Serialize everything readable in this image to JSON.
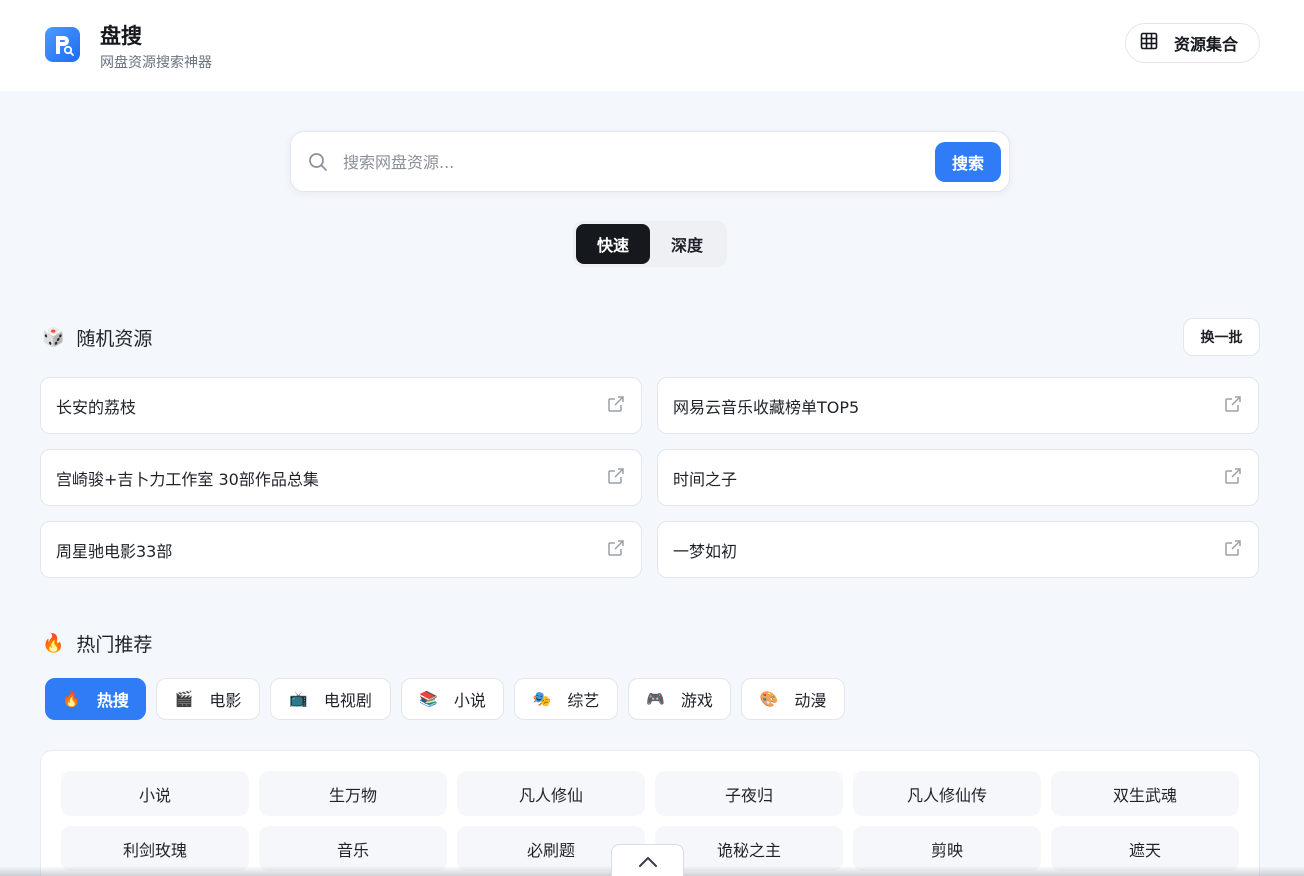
{
  "header": {
    "title": "盘搜",
    "subtitle": "网盘资源搜索神器",
    "collection_button": "资源集合"
  },
  "search": {
    "placeholder": "搜索网盘资源...",
    "button": "搜索"
  },
  "modes": [
    {
      "label": "快速",
      "active": true
    },
    {
      "label": "深度",
      "active": false
    }
  ],
  "random": {
    "title": "随机资源",
    "icon": "🎲",
    "refresh_button": "换一批",
    "items": [
      "长安的荔枝",
      "网易云音乐收藏榜单TOP5",
      "宫崎骏+吉卜力工作室 30部作品总集",
      "时间之子",
      "周星驰电影33部",
      "一梦如初"
    ]
  },
  "hot": {
    "title": "热门推荐",
    "icon": "🔥",
    "tabs": [
      {
        "label": "热搜",
        "icon": "🔥",
        "active": true
      },
      {
        "label": "电影",
        "icon": "🎬",
        "active": false
      },
      {
        "label": "电视剧",
        "icon": "📺",
        "active": false
      },
      {
        "label": "小说",
        "icon": "📚",
        "active": false
      },
      {
        "label": "综艺",
        "icon": "🎭",
        "active": false
      },
      {
        "label": "游戏",
        "icon": "🎮",
        "active": false
      },
      {
        "label": "动漫",
        "icon": "🎨",
        "active": false
      }
    ],
    "keywords": [
      "小说",
      "生万物",
      "凡人修仙",
      "子夜归",
      "凡人修仙传",
      "双生武魂",
      "利剑玫瑰",
      "音乐",
      "必刷题",
      "诡秘之主",
      "剪映",
      "遮天"
    ]
  },
  "colors": {
    "accent": "#2f7cf6",
    "dark": "#15181d",
    "background": "#f4f7fc"
  }
}
